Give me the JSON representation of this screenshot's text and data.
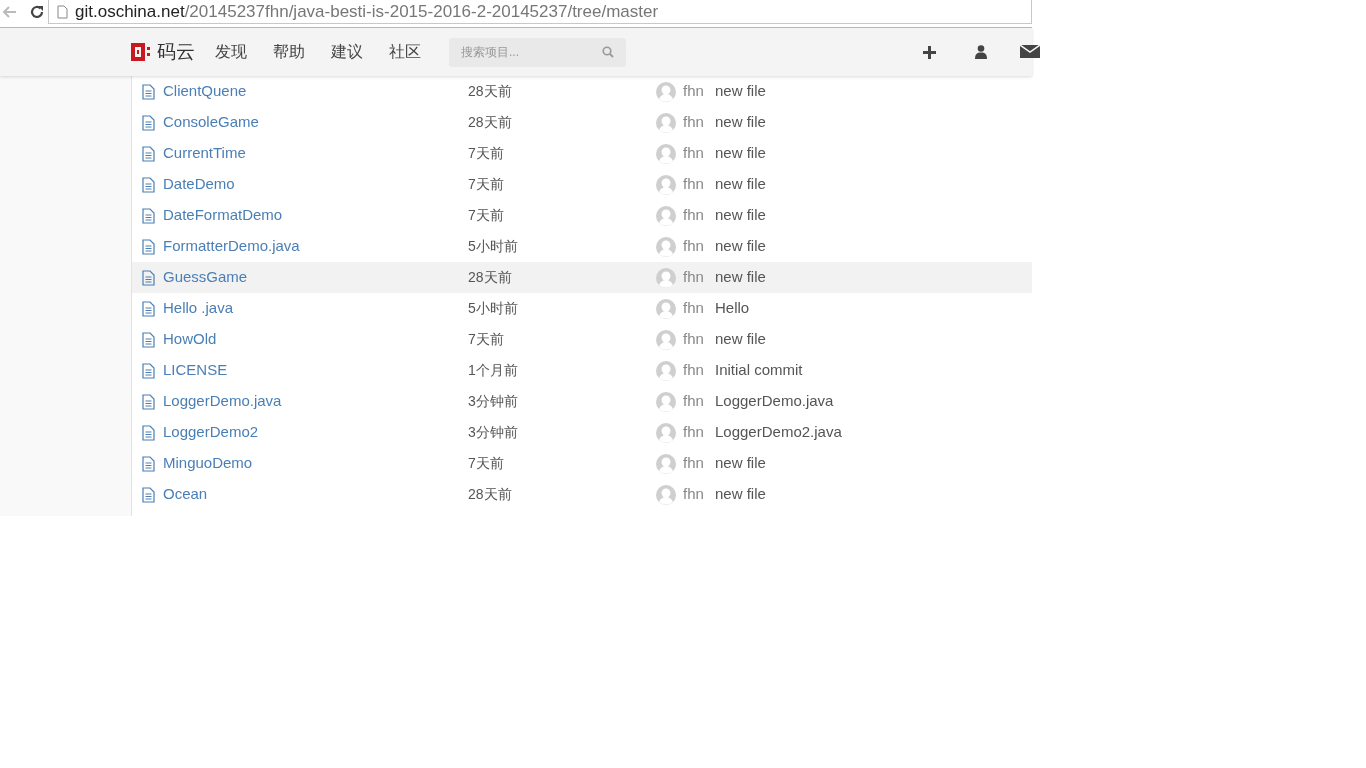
{
  "browser": {
    "url_host": "git.oschina.net",
    "url_path": "/20145237fhn/java-besti-is-2015-2016-2-20145237/tree/master"
  },
  "header": {
    "logo_text": "码云",
    "nav": [
      "发现",
      "帮助",
      "建议",
      "社区"
    ],
    "search": {
      "placeholder": "搜索项目..."
    }
  },
  "files": [
    {
      "name": "ClientQuene",
      "time": "28天前",
      "author": "fhn",
      "message": "new file",
      "highlighted": false
    },
    {
      "name": "ConsoleGame",
      "time": "28天前",
      "author": "fhn",
      "message": "new file",
      "highlighted": false
    },
    {
      "name": "CurrentTime",
      "time": "7天前",
      "author": "fhn",
      "message": "new file",
      "highlighted": false
    },
    {
      "name": "DateDemo",
      "time": "7天前",
      "author": "fhn",
      "message": "new file",
      "highlighted": false
    },
    {
      "name": "DateFormatDemo",
      "time": "7天前",
      "author": "fhn",
      "message": "new file",
      "highlighted": false
    },
    {
      "name": "FormatterDemo.java",
      "time": "5小时前",
      "author": "fhn",
      "message": "new file",
      "highlighted": false
    },
    {
      "name": "GuessGame",
      "time": "28天前",
      "author": "fhn",
      "message": "new file",
      "highlighted": true
    },
    {
      "name": "Hello .java",
      "time": "5小时前",
      "author": "fhn",
      "message": "Hello",
      "highlighted": false
    },
    {
      "name": "HowOld",
      "time": "7天前",
      "author": "fhn",
      "message": "new file",
      "highlighted": false
    },
    {
      "name": "LICENSE",
      "time": "1个月前",
      "author": "fhn",
      "message": "Initial commit",
      "highlighted": false
    },
    {
      "name": "LoggerDemo.java",
      "time": "3分钟前",
      "author": "fhn",
      "message": "LoggerDemo.java",
      "highlighted": false
    },
    {
      "name": "LoggerDemo2",
      "time": "3分钟前",
      "author": "fhn",
      "message": "LoggerDemo2.java",
      "highlighted": false
    },
    {
      "name": "MinguoDemo",
      "time": "7天前",
      "author": "fhn",
      "message": "new file",
      "highlighted": false
    },
    {
      "name": "Ocean",
      "time": "28天前",
      "author": "fhn",
      "message": "new file",
      "highlighted": false
    }
  ]
}
